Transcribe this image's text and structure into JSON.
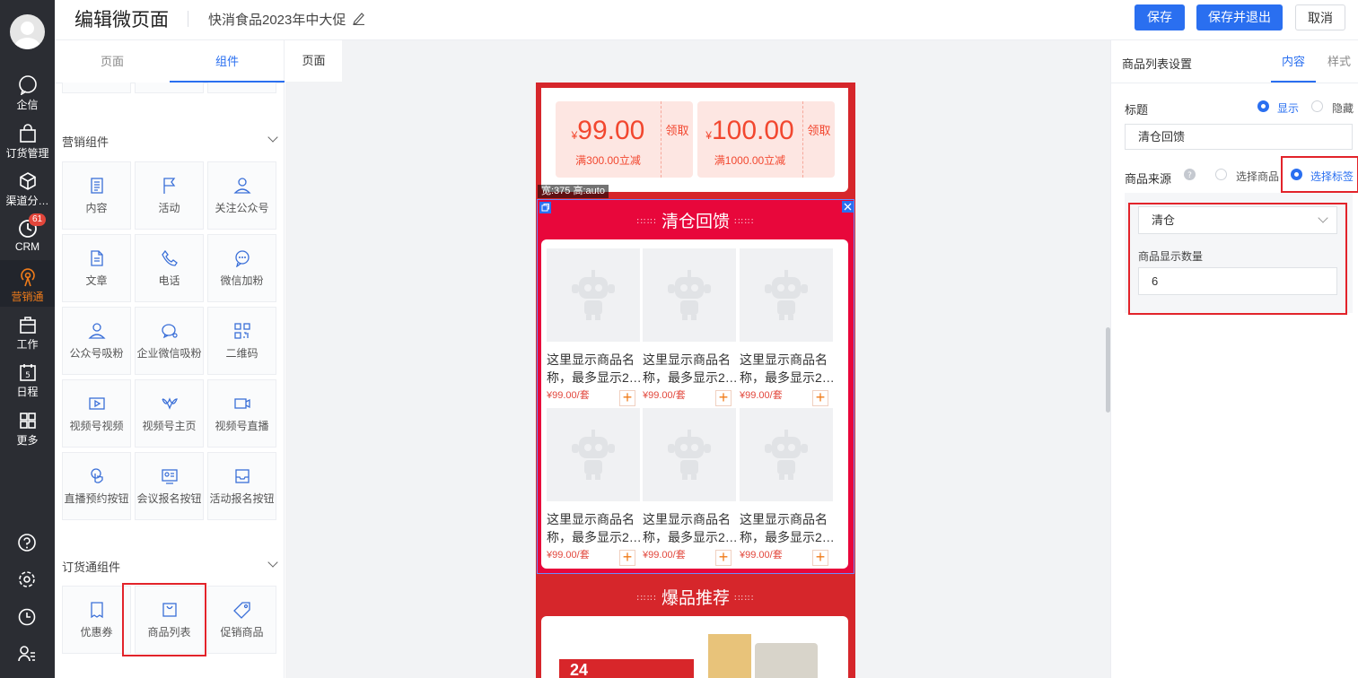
{
  "nav": {
    "items": [
      {
        "label": "企信",
        "icon": "chat-bubble-icon"
      },
      {
        "label": "订货管理",
        "icon": "bag-icon"
      },
      {
        "label": "渠道分…",
        "icon": "cube-icon"
      },
      {
        "label": "CRM",
        "icon": "clock-icon",
        "badge": "61"
      },
      {
        "label": "营销通",
        "icon": "broadcast-icon",
        "active": true
      },
      {
        "label": "工作",
        "icon": "briefcase-icon"
      },
      {
        "label": "日程",
        "icon": "calendar-icon",
        "calendar_day": "5"
      },
      {
        "label": "更多",
        "icon": "grid-icon"
      }
    ],
    "bottom_icons": [
      "help-icon",
      "settings-icon",
      "history-icon",
      "user-list-icon"
    ]
  },
  "header": {
    "title": "编辑微页面",
    "subtitle": "快消食品2023年中大促",
    "save": "保存",
    "save_exit": "保存并退出",
    "cancel": "取消"
  },
  "left": {
    "tabs": [
      "页面",
      "组件"
    ],
    "active_tab": "组件",
    "marketing": {
      "title": "营销组件",
      "items": [
        {
          "label": "内容",
          "icon": "document-icon"
        },
        {
          "label": "活动",
          "icon": "flag-icon"
        },
        {
          "label": "关注公众号",
          "icon": "user-follow-icon"
        },
        {
          "label": "文章",
          "icon": "article-icon"
        },
        {
          "label": "电话",
          "icon": "phone-icon"
        },
        {
          "label": "微信加粉",
          "icon": "wechat-icon"
        },
        {
          "label": "公众号吸粉",
          "icon": "user-follow-icon"
        },
        {
          "label": "企业微信吸粉",
          "icon": "wecom-icon"
        },
        {
          "label": "二维码",
          "icon": "qrcode-icon"
        },
        {
          "label": "视频号视频",
          "icon": "video-icon"
        },
        {
          "label": "视频号主页",
          "icon": "channels-icon"
        },
        {
          "label": "视频号直播",
          "icon": "live-icon"
        },
        {
          "label": "直播预约按钮",
          "icon": "touch-icon"
        },
        {
          "label": "会议报名按钮",
          "icon": "meeting-icon"
        },
        {
          "label": "活动报名按钮",
          "icon": "inbox-icon"
        }
      ]
    },
    "ordering": {
      "title": "订货通组件",
      "items": [
        {
          "label": "优惠券",
          "icon": "coupon-icon"
        },
        {
          "label": "商品列表",
          "icon": "shopping-bag-icon"
        },
        {
          "label": "促销商品",
          "icon": "tag-icon"
        }
      ]
    }
  },
  "canvas": {
    "tab": "页面",
    "coupons": [
      {
        "symbol": "¥",
        "amount": "99.00",
        "condition": "满300.00立减",
        "action": "领取"
      },
      {
        "symbol": "¥",
        "amount": "100.00",
        "condition": "满1000.00立减",
        "action": "领取"
      }
    ],
    "size_label": "宽:375 高:auto",
    "section1_title": "清仓回馈",
    "product_name_line1": "这里显示商品名",
    "product_name_line2": "称，最多显示2…",
    "product_price": "¥99.00/套",
    "section2_title": "爆品推荐",
    "promo_badge": "24"
  },
  "right": {
    "title": "商品列表设置",
    "tabs": [
      "内容",
      "样式"
    ],
    "active_tab": "内容",
    "title_label": "标题",
    "show": "显示",
    "hide": "隐藏",
    "title_value": "清仓回馈",
    "source_label": "商品来源",
    "source_opt1": "选择商品",
    "source_opt2": "选择标签",
    "tag_value": "清仓",
    "count_label": "商品显示数量",
    "count_value": "6"
  },
  "colors": {
    "accent": "#2a6ff0",
    "nav_bg": "#2b2d33",
    "phone_bg": "#d6262b",
    "active_section": "#e8073b",
    "highlight": "#e2232a",
    "price": "#e2463b"
  }
}
